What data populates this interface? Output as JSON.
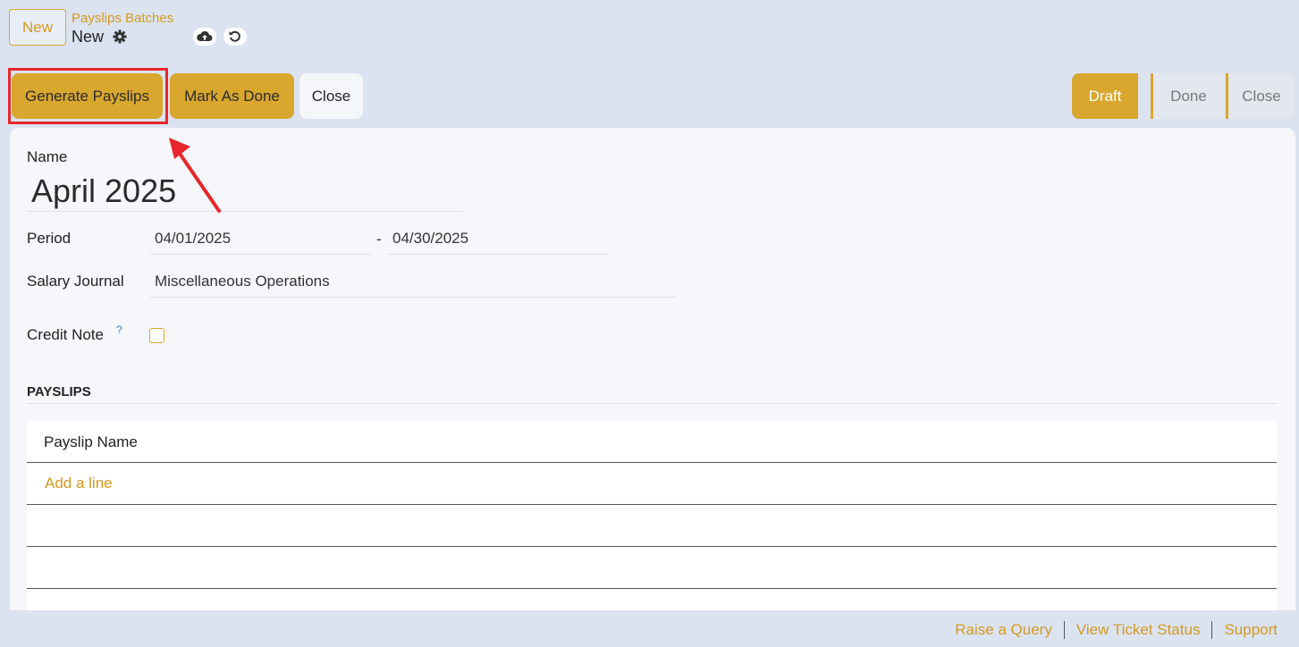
{
  "header": {
    "new_button": "New",
    "breadcrumb": "Payslips Batches",
    "record_name": "New",
    "icons": [
      "gear-icon",
      "cloud-upload-icon",
      "discard-icon"
    ]
  },
  "actions": {
    "generate": "Generate Payslips",
    "mark_done": "Mark As Done",
    "close": "Close"
  },
  "statusbar": {
    "stages": [
      "Draft",
      "Done",
      "Close"
    ],
    "active": "Draft"
  },
  "form": {
    "name_label": "Name",
    "name_value": "April 2025",
    "period_label": "Period",
    "period_start": "04/01/2025",
    "period_sep": "-",
    "period_end": "04/30/2025",
    "journal_label": "Salary Journal",
    "journal_value": "Miscellaneous Operations",
    "credit_note_label": "Credit Note",
    "credit_note_help": "?",
    "credit_note_checked": false
  },
  "payslips": {
    "section_title": "PAYSLIPS",
    "column": "Payslip Name",
    "add_line": "Add a line"
  },
  "footer": {
    "links": [
      "Raise a Query",
      "View Ticket Status",
      "Support"
    ]
  },
  "colors": {
    "accent": "#d9a62e",
    "background": "#dbe3f1",
    "highlight": "#e8262b"
  }
}
